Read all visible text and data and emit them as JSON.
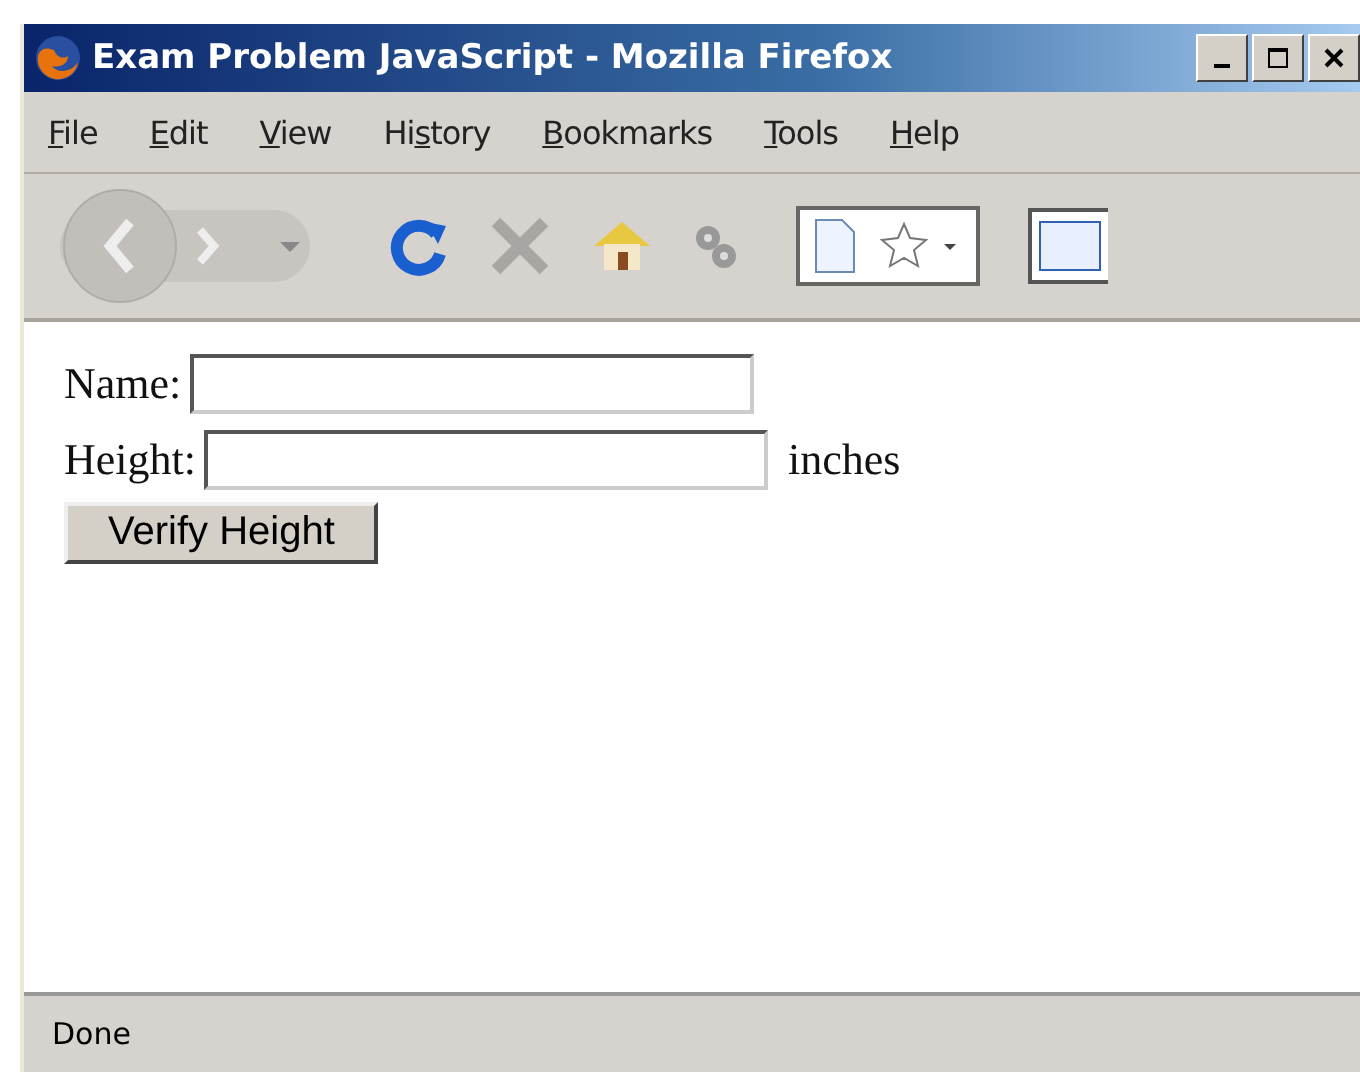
{
  "window": {
    "title": "Exam Problem JavaScript - Mozilla Firefox"
  },
  "menu": [
    {
      "label": "File"
    },
    {
      "label": "Edit"
    },
    {
      "label": "View"
    },
    {
      "label": "History"
    },
    {
      "label": "Bookmarks"
    },
    {
      "label": "Tools"
    },
    {
      "label": "Help"
    }
  ],
  "form": {
    "name_label": "Name:",
    "height_label": "Height:",
    "unit": "inches",
    "button": "Verify Height"
  },
  "status_bar": {
    "text": "Done"
  }
}
